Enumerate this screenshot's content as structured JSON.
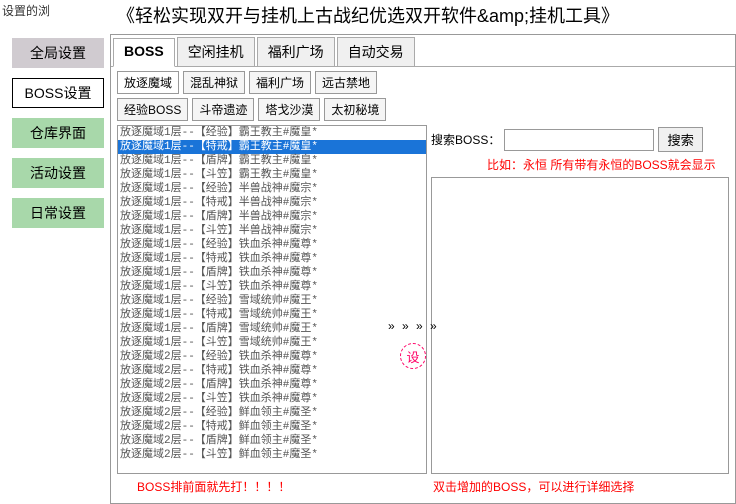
{
  "corner_text": "设置的浏",
  "title": "《轻松实现双开与挂机上古战纪优选双开软件&amp;挂机工具》",
  "sidebar": {
    "items": [
      {
        "label": "全局设置",
        "cls": "side-gray"
      },
      {
        "label": "BOSS设置",
        "cls": "side-white"
      },
      {
        "label": "仓库界面",
        "cls": "side-green"
      },
      {
        "label": "活动设置",
        "cls": "side-green"
      },
      {
        "label": "日常设置",
        "cls": "side-green"
      }
    ]
  },
  "main_tabs": [
    {
      "label": "BOSS",
      "active": true
    },
    {
      "label": "空闲挂机",
      "active": false
    },
    {
      "label": "福利广场",
      "active": false
    },
    {
      "label": "自动交易",
      "active": false
    }
  ],
  "sub_tabs_row1": [
    {
      "label": "放逐魔域",
      "active": true
    },
    {
      "label": "混乱神狱",
      "active": false
    },
    {
      "label": "福利广场",
      "active": false
    },
    {
      "label": "远古禁地",
      "active": false
    }
  ],
  "sub_tabs_row2": [
    {
      "label": "经验BOSS",
      "active": false
    },
    {
      "label": "斗帝遗迹",
      "active": false
    },
    {
      "label": "塔戈沙漠",
      "active": false
    },
    {
      "label": "太初秘境",
      "active": false
    }
  ],
  "search": {
    "label": "搜索BOSS：",
    "button": "搜索",
    "value": ""
  },
  "hint": "比如：永恒  所有带有永恒的BOSS就会显示",
  "boss_list": [
    {
      "t": "放逐魔域1层--【经验】霸王教主#魔皇*",
      "sel": false
    },
    {
      "t": "放逐魔域1层--【特戒】霸王教主#魔皇*",
      "sel": true
    },
    {
      "t": "放逐魔域1层--【盾牌】霸王教主#魔皇*",
      "sel": false
    },
    {
      "t": "放逐魔域1层--【斗笠】霸王教主#魔皇*",
      "sel": false
    },
    {
      "t": "放逐魔域1层--【经验】半兽战神#魔宗*",
      "sel": false
    },
    {
      "t": "放逐魔域1层--【特戒】半兽战神#魔宗*",
      "sel": false
    },
    {
      "t": "放逐魔域1层--【盾牌】半兽战神#魔宗*",
      "sel": false
    },
    {
      "t": "放逐魔域1层--【斗笠】半兽战神#魔宗*",
      "sel": false
    },
    {
      "t": "放逐魔域1层--【经验】铁血杀神#魔尊*",
      "sel": false
    },
    {
      "t": "放逐魔域1层--【特戒】铁血杀神#魔尊*",
      "sel": false
    },
    {
      "t": "放逐魔域1层--【盾牌】铁血杀神#魔尊*",
      "sel": false
    },
    {
      "t": "放逐魔域1层--【斗笠】铁血杀神#魔尊*",
      "sel": false
    },
    {
      "t": "放逐魔域1层--【经验】雪域统帅#魔王*",
      "sel": false
    },
    {
      "t": "放逐魔域1层--【特戒】雪域统帅#魔王*",
      "sel": false
    },
    {
      "t": "放逐魔域1层--【盾牌】雪域统帅#魔王*",
      "sel": false
    },
    {
      "t": "放逐魔域1层--【斗笠】雪域统帅#魔王*",
      "sel": false
    },
    {
      "t": "放逐魔域2层--【经验】铁血杀神#魔尊*",
      "sel": false
    },
    {
      "t": "放逐魔域2层--【特戒】铁血杀神#魔尊*",
      "sel": false
    },
    {
      "t": "放逐魔域2层--【盾牌】铁血杀神#魔尊*",
      "sel": false
    },
    {
      "t": "放逐魔域2层--【斗笠】铁血杀神#魔尊*",
      "sel": false
    },
    {
      "t": "放逐魔域2层--【经验】鲜血领主#魔圣*",
      "sel": false
    },
    {
      "t": "放逐魔域2层--【特戒】鲜血领主#魔圣*",
      "sel": false
    },
    {
      "t": "放逐魔域2层--【盾牌】鲜血领主#魔圣*",
      "sel": false
    },
    {
      "t": "放逐魔域2层--【斗笠】鲜血领主#魔圣*",
      "sel": false
    }
  ],
  "arrows_text": "» » » »",
  "circle_label": "设",
  "left_note": "BOSS排前面就先打！！！！",
  "right_note": "双击增加的BOSS，可以进行详细选择"
}
